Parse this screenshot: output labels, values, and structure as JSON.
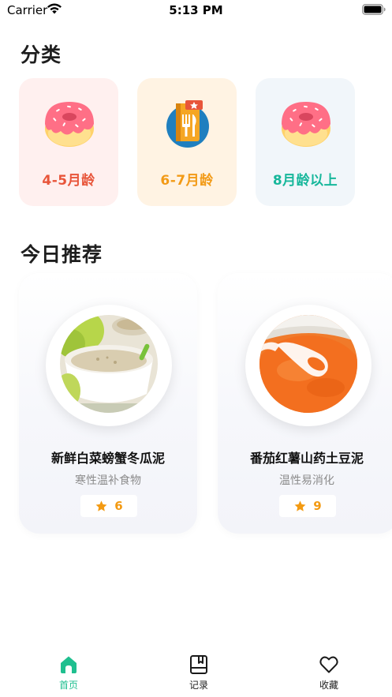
{
  "status_bar": {
    "carrier": "Carrier",
    "time": "5:13 PM"
  },
  "categories": {
    "title": "分类",
    "items": [
      {
        "label": "4-5月龄",
        "icon": "donut-icon",
        "color": "#e8553a",
        "bg": "#fff0ef"
      },
      {
        "label": "6-7月龄",
        "icon": "recipe-book-icon",
        "color": "#f29a16",
        "bg": "#fff3e3"
      },
      {
        "label": "8月龄以上",
        "icon": "donut-icon",
        "color": "#17b79b",
        "bg": "#f1f6fa"
      }
    ]
  },
  "recommendations": {
    "title": "今日推荐",
    "items": [
      {
        "name": "新鲜白菜螃蟹冬瓜泥",
        "desc": "寒性温补食物",
        "rating": "6",
        "image": "porridge-bowl-image"
      },
      {
        "name": "番茄红薯山药土豆泥",
        "desc": "温性易消化",
        "rating": "9",
        "image": "orange-puree-image"
      }
    ]
  },
  "tab_bar": {
    "tabs": [
      {
        "label": "首页",
        "icon": "home-icon",
        "active": true
      },
      {
        "label": "记录",
        "icon": "notebook-icon",
        "active": false
      },
      {
        "label": "收藏",
        "icon": "heart-icon",
        "active": false
      }
    ]
  },
  "colors": {
    "accent": "#1fbf8f",
    "star": "#f39a12"
  }
}
